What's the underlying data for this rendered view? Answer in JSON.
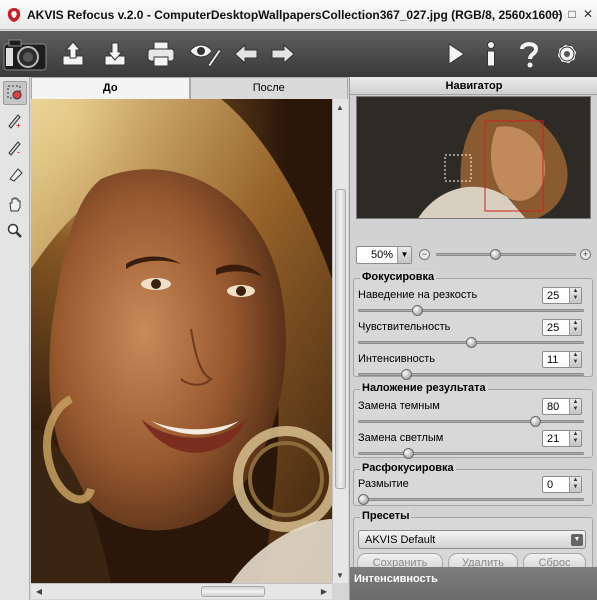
{
  "window": {
    "title": "AKVIS Refocus v.2.0 - ComputerDesktopWallpapersCollection367_027.jpg (RGB/8, 2560x1600)",
    "minimize_glyph": "─",
    "restore_glyph": "□",
    "close_glyph": "✕"
  },
  "toolbar": {
    "icons": [
      "camera-logo-icon",
      "upload-icon",
      "download-icon",
      "printer-icon",
      "eye-brush-icon",
      "undo-arrow-icon",
      "redo-arrow-icon",
      "play-icon",
      "info-icon",
      "help-icon",
      "gear-icon"
    ]
  },
  "left_tools": {
    "icons": [
      "focus-area-icon",
      "pencil-plus-icon",
      "pencil-minus-icon",
      "eraser-icon",
      "hand-icon",
      "zoom-icon"
    ],
    "active": "focus-area-icon"
  },
  "tabs": {
    "before": "До",
    "after": "После"
  },
  "navigator": {
    "title": "Навигатор",
    "zoom_value": "50%",
    "zoom_minus": "−",
    "zoom_plus": "+",
    "zoom_slider_fraction": 0.42
  },
  "focus": {
    "title": "Фокусировка",
    "params": [
      {
        "label": "Наведение на резкость",
        "value": "25",
        "fraction": 0.25
      },
      {
        "label": "Чувствительность",
        "value": "25",
        "fraction": 0.5
      },
      {
        "label": "Интенсивность",
        "value": "11",
        "fraction": 0.2
      }
    ]
  },
  "overlay": {
    "title": "Наложение результата",
    "params": [
      {
        "label": "Замена темным",
        "value": "80",
        "fraction": 0.8
      },
      {
        "label": "Замена светлым",
        "value": "21",
        "fraction": 0.21
      }
    ]
  },
  "defocus": {
    "title": "Расфокусировка",
    "params": [
      {
        "label": "Размытие",
        "value": "0",
        "fraction": 0.0
      }
    ]
  },
  "presets": {
    "title": "Пресеты",
    "selected": "AKVIS Default",
    "save_label": "Сохранить",
    "delete_label": "Удалить",
    "reset_label": "Сброс"
  },
  "hint": {
    "text": "Интенсивность"
  },
  "colors": {
    "toolbar_bg": "#4a4a4a",
    "panel_bg": "#d8d8d8",
    "hint_bg": "#737373",
    "accent_red": "#cc2222"
  }
}
